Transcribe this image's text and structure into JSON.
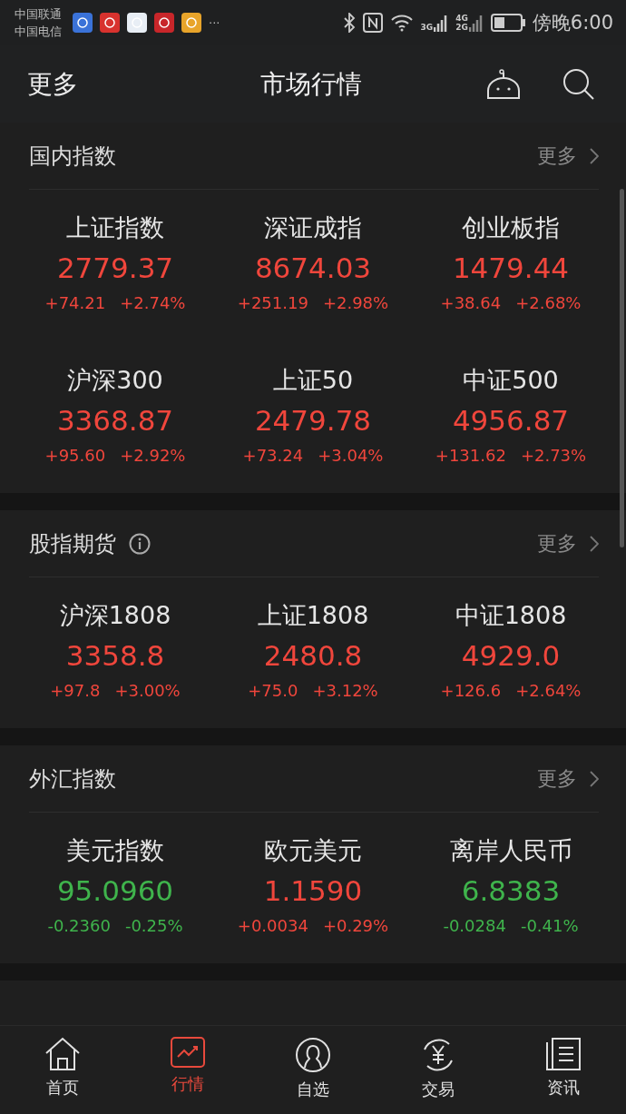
{
  "status_bar": {
    "carriers": [
      "中国联通",
      "中国电信"
    ],
    "notification_icons": [
      {
        "color": "#3a72d8"
      },
      {
        "color": "#d8322e"
      },
      {
        "color": "#e8eef5"
      },
      {
        "color": "#c8262a"
      },
      {
        "color": "#e8a42a"
      }
    ],
    "more": "···",
    "network_3g": "3G",
    "network_4g": "4G",
    "network_2g": "2G",
    "time": "傍晚6:00"
  },
  "header": {
    "left": "更多",
    "title": "市场行情"
  },
  "sections": [
    {
      "title": "国内指数",
      "info": false,
      "more": "更多",
      "quotes": [
        {
          "name": "上证指数",
          "value": "2779.37",
          "change": "+74.21",
          "pct": "+2.74%",
          "color": "#f0463c"
        },
        {
          "name": "深证成指",
          "value": "8674.03",
          "change": "+251.19",
          "pct": "+2.98%",
          "color": "#f0463c"
        },
        {
          "name": "创业板指",
          "value": "1479.44",
          "change": "+38.64",
          "pct": "+2.68%",
          "color": "#f0463c"
        },
        {
          "name": "沪深300",
          "value": "3368.87",
          "change": "+95.60",
          "pct": "+2.92%",
          "color": "#f0463c"
        },
        {
          "name": "上证50",
          "value": "2479.78",
          "change": "+73.24",
          "pct": "+3.04%",
          "color": "#f0463c"
        },
        {
          "name": "中证500",
          "value": "4956.87",
          "change": "+131.62",
          "pct": "+2.73%",
          "color": "#f0463c"
        }
      ]
    },
    {
      "title": "股指期货",
      "info": true,
      "more": "更多",
      "quotes": [
        {
          "name": "沪深1808",
          "value": "3358.8",
          "change": "+97.8",
          "pct": "+3.00%",
          "color": "#f0463c"
        },
        {
          "name": "上证1808",
          "value": "2480.8",
          "change": "+75.0",
          "pct": "+3.12%",
          "color": "#f0463c"
        },
        {
          "name": "中证1808",
          "value": "4929.0",
          "change": "+126.6",
          "pct": "+2.64%",
          "color": "#f0463c"
        }
      ]
    },
    {
      "title": "外汇指数",
      "info": false,
      "more": "更多",
      "quotes": [
        {
          "name": "美元指数",
          "value": "95.0960",
          "change": "-0.2360",
          "pct": "-0.25%",
          "color": "#3fb44c"
        },
        {
          "name": "欧元美元",
          "value": "1.1590",
          "change": "+0.0034",
          "pct": "+0.29%",
          "color": "#f0463c"
        },
        {
          "name": "离岸人民币",
          "value": "6.8383",
          "change": "-0.0284",
          "pct": "-0.41%",
          "color": "#3fb44c"
        }
      ]
    }
  ],
  "tab_bar": [
    {
      "label": "首页",
      "kind": "home",
      "selected": false
    },
    {
      "label": "行情",
      "kind": "chart",
      "selected": true
    },
    {
      "label": "自选",
      "kind": "person",
      "selected": false
    },
    {
      "label": "交易",
      "kind": "exchange",
      "selected": false
    },
    {
      "label": "资讯",
      "kind": "news",
      "selected": false
    }
  ]
}
